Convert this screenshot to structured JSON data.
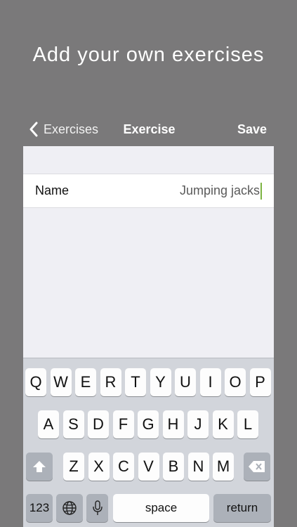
{
  "promo": {
    "headline": "Add your own exercises"
  },
  "navbar": {
    "back_label": "Exercises",
    "title": "Exercise",
    "save_label": "Save"
  },
  "form": {
    "name_label": "Name",
    "name_value": "Jumping jacks"
  },
  "keyboard": {
    "row1": [
      "Q",
      "W",
      "E",
      "R",
      "T",
      "Y",
      "U",
      "I",
      "O",
      "P"
    ],
    "row2": [
      "A",
      "S",
      "D",
      "F",
      "G",
      "H",
      "J",
      "K",
      "L"
    ],
    "row3": [
      "Z",
      "X",
      "C",
      "V",
      "B",
      "N",
      "M"
    ],
    "numbers_label": "123",
    "space_label": "space",
    "return_label": "return",
    "icons": {
      "shift": "shift-icon",
      "delete": "delete-icon",
      "globe": "globe-icon",
      "mic": "microphone-icon",
      "back": "chevron-left-icon"
    }
  },
  "colors": {
    "background": "#7a797a",
    "caret": "#7cb342",
    "keyboard": "#d2d5db"
  }
}
